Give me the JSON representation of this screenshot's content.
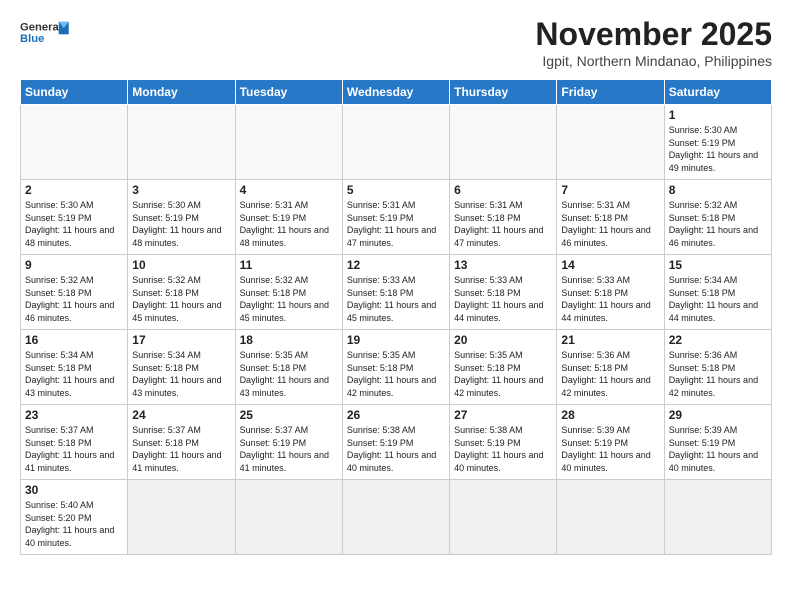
{
  "header": {
    "logo_general": "General",
    "logo_blue": "Blue",
    "month_title": "November 2025",
    "location": "Igpit, Northern Mindanao, Philippines"
  },
  "weekdays": [
    "Sunday",
    "Monday",
    "Tuesday",
    "Wednesday",
    "Thursday",
    "Friday",
    "Saturday"
  ],
  "weeks": [
    [
      {
        "day": "",
        "sunrise": "",
        "sunset": "",
        "daylight": ""
      },
      {
        "day": "",
        "sunrise": "",
        "sunset": "",
        "daylight": ""
      },
      {
        "day": "",
        "sunrise": "",
        "sunset": "",
        "daylight": ""
      },
      {
        "day": "",
        "sunrise": "",
        "sunset": "",
        "daylight": ""
      },
      {
        "day": "",
        "sunrise": "",
        "sunset": "",
        "daylight": ""
      },
      {
        "day": "",
        "sunrise": "",
        "sunset": "",
        "daylight": ""
      },
      {
        "day": "1",
        "sunrise": "Sunrise: 5:30 AM",
        "sunset": "Sunset: 5:19 PM",
        "daylight": "Daylight: 11 hours and 49 minutes."
      }
    ],
    [
      {
        "day": "2",
        "sunrise": "Sunrise: 5:30 AM",
        "sunset": "Sunset: 5:19 PM",
        "daylight": "Daylight: 11 hours and 48 minutes."
      },
      {
        "day": "3",
        "sunrise": "Sunrise: 5:30 AM",
        "sunset": "Sunset: 5:19 PM",
        "daylight": "Daylight: 11 hours and 48 minutes."
      },
      {
        "day": "4",
        "sunrise": "Sunrise: 5:31 AM",
        "sunset": "Sunset: 5:19 PM",
        "daylight": "Daylight: 11 hours and 48 minutes."
      },
      {
        "day": "5",
        "sunrise": "Sunrise: 5:31 AM",
        "sunset": "Sunset: 5:19 PM",
        "daylight": "Daylight: 11 hours and 47 minutes."
      },
      {
        "day": "6",
        "sunrise": "Sunrise: 5:31 AM",
        "sunset": "Sunset: 5:18 PM",
        "daylight": "Daylight: 11 hours and 47 minutes."
      },
      {
        "day": "7",
        "sunrise": "Sunrise: 5:31 AM",
        "sunset": "Sunset: 5:18 PM",
        "daylight": "Daylight: 11 hours and 46 minutes."
      },
      {
        "day": "8",
        "sunrise": "Sunrise: 5:32 AM",
        "sunset": "Sunset: 5:18 PM",
        "daylight": "Daylight: 11 hours and 46 minutes."
      }
    ],
    [
      {
        "day": "9",
        "sunrise": "Sunrise: 5:32 AM",
        "sunset": "Sunset: 5:18 PM",
        "daylight": "Daylight: 11 hours and 46 minutes."
      },
      {
        "day": "10",
        "sunrise": "Sunrise: 5:32 AM",
        "sunset": "Sunset: 5:18 PM",
        "daylight": "Daylight: 11 hours and 45 minutes."
      },
      {
        "day": "11",
        "sunrise": "Sunrise: 5:32 AM",
        "sunset": "Sunset: 5:18 PM",
        "daylight": "Daylight: 11 hours and 45 minutes."
      },
      {
        "day": "12",
        "sunrise": "Sunrise: 5:33 AM",
        "sunset": "Sunset: 5:18 PM",
        "daylight": "Daylight: 11 hours and 45 minutes."
      },
      {
        "day": "13",
        "sunrise": "Sunrise: 5:33 AM",
        "sunset": "Sunset: 5:18 PM",
        "daylight": "Daylight: 11 hours and 44 minutes."
      },
      {
        "day": "14",
        "sunrise": "Sunrise: 5:33 AM",
        "sunset": "Sunset: 5:18 PM",
        "daylight": "Daylight: 11 hours and 44 minutes."
      },
      {
        "day": "15",
        "sunrise": "Sunrise: 5:34 AM",
        "sunset": "Sunset: 5:18 PM",
        "daylight": "Daylight: 11 hours and 44 minutes."
      }
    ],
    [
      {
        "day": "16",
        "sunrise": "Sunrise: 5:34 AM",
        "sunset": "Sunset: 5:18 PM",
        "daylight": "Daylight: 11 hours and 43 minutes."
      },
      {
        "day": "17",
        "sunrise": "Sunrise: 5:34 AM",
        "sunset": "Sunset: 5:18 PM",
        "daylight": "Daylight: 11 hours and 43 minutes."
      },
      {
        "day": "18",
        "sunrise": "Sunrise: 5:35 AM",
        "sunset": "Sunset: 5:18 PM",
        "daylight": "Daylight: 11 hours and 43 minutes."
      },
      {
        "day": "19",
        "sunrise": "Sunrise: 5:35 AM",
        "sunset": "Sunset: 5:18 PM",
        "daylight": "Daylight: 11 hours and 42 minutes."
      },
      {
        "day": "20",
        "sunrise": "Sunrise: 5:35 AM",
        "sunset": "Sunset: 5:18 PM",
        "daylight": "Daylight: 11 hours and 42 minutes."
      },
      {
        "day": "21",
        "sunrise": "Sunrise: 5:36 AM",
        "sunset": "Sunset: 5:18 PM",
        "daylight": "Daylight: 11 hours and 42 minutes."
      },
      {
        "day": "22",
        "sunrise": "Sunrise: 5:36 AM",
        "sunset": "Sunset: 5:18 PM",
        "daylight": "Daylight: 11 hours and 42 minutes."
      }
    ],
    [
      {
        "day": "23",
        "sunrise": "Sunrise: 5:37 AM",
        "sunset": "Sunset: 5:18 PM",
        "daylight": "Daylight: 11 hours and 41 minutes."
      },
      {
        "day": "24",
        "sunrise": "Sunrise: 5:37 AM",
        "sunset": "Sunset: 5:18 PM",
        "daylight": "Daylight: 11 hours and 41 minutes."
      },
      {
        "day": "25",
        "sunrise": "Sunrise: 5:37 AM",
        "sunset": "Sunset: 5:19 PM",
        "daylight": "Daylight: 11 hours and 41 minutes."
      },
      {
        "day": "26",
        "sunrise": "Sunrise: 5:38 AM",
        "sunset": "Sunset: 5:19 PM",
        "daylight": "Daylight: 11 hours and 40 minutes."
      },
      {
        "day": "27",
        "sunrise": "Sunrise: 5:38 AM",
        "sunset": "Sunset: 5:19 PM",
        "daylight": "Daylight: 11 hours and 40 minutes."
      },
      {
        "day": "28",
        "sunrise": "Sunrise: 5:39 AM",
        "sunset": "Sunset: 5:19 PM",
        "daylight": "Daylight: 11 hours and 40 minutes."
      },
      {
        "day": "29",
        "sunrise": "Sunrise: 5:39 AM",
        "sunset": "Sunset: 5:19 PM",
        "daylight": "Daylight: 11 hours and 40 minutes."
      }
    ],
    [
      {
        "day": "30",
        "sunrise": "Sunrise: 5:40 AM",
        "sunset": "Sunset: 5:20 PM",
        "daylight": "Daylight: 11 hours and 40 minutes."
      },
      {
        "day": "",
        "sunrise": "",
        "sunset": "",
        "daylight": ""
      },
      {
        "day": "",
        "sunrise": "",
        "sunset": "",
        "daylight": ""
      },
      {
        "day": "",
        "sunrise": "",
        "sunset": "",
        "daylight": ""
      },
      {
        "day": "",
        "sunrise": "",
        "sunset": "",
        "daylight": ""
      },
      {
        "day": "",
        "sunrise": "",
        "sunset": "",
        "daylight": ""
      },
      {
        "day": "",
        "sunrise": "",
        "sunset": "",
        "daylight": ""
      }
    ]
  ]
}
